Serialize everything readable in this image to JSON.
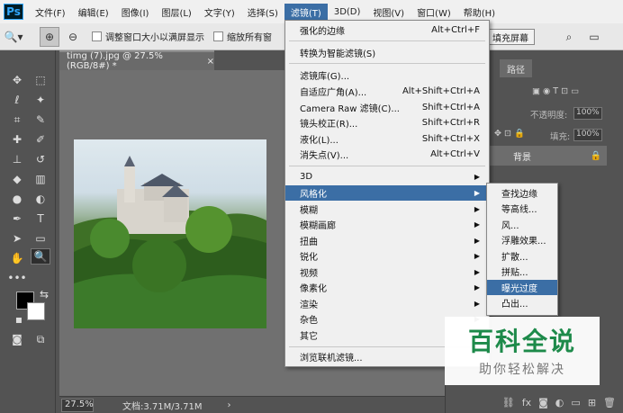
{
  "menubar": {
    "logo": "Ps",
    "items": [
      "文件(F)",
      "编辑(E)",
      "图像(I)",
      "图层(L)",
      "文字(Y)",
      "选择(S)",
      "滤镜(T)",
      "3D(D)",
      "视图(V)",
      "窗口(W)",
      "帮助(H)"
    ],
    "active_index": 6
  },
  "options": {
    "resize_windows": "调整窗口大小以满屏显示",
    "zoom_all": "缩放所有窗",
    "fill_screen": "填充屏幕"
  },
  "document": {
    "tab_title": "timg (7).jpg @ 27.5%(RGB/8#) *",
    "close": "×",
    "zoom": "27.5%",
    "doc_info": "文档:3.71M/3.71M",
    "status_arrow": "›"
  },
  "panel": {
    "tab": "路径",
    "opacity_label": "不透明度:",
    "opacity_value": "100%",
    "fill_label": "填充:",
    "fill_value": "100%",
    "layer_name": "背景"
  },
  "filter_menu": {
    "items": [
      {
        "label": "强化的边缘",
        "shortcut": "Alt+Ctrl+F"
      },
      {
        "label": "转换为智能滤镜(S)",
        "shortcut": ""
      },
      {
        "label": "滤镜库(G)...",
        "shortcut": ""
      },
      {
        "label": "自适应广角(A)...",
        "shortcut": "Alt+Shift+Ctrl+A"
      },
      {
        "label": "Camera Raw 滤镜(C)...",
        "shortcut": "Shift+Ctrl+A"
      },
      {
        "label": "镜头校正(R)...",
        "shortcut": "Shift+Ctrl+R"
      },
      {
        "label": "液化(L)...",
        "shortcut": "Shift+Ctrl+X"
      },
      {
        "label": "消失点(V)...",
        "shortcut": "Alt+Ctrl+V"
      },
      {
        "label": "3D",
        "shortcut": ""
      },
      {
        "label": "风格化",
        "shortcut": ""
      },
      {
        "label": "模糊",
        "shortcut": ""
      },
      {
        "label": "模糊画廊",
        "shortcut": ""
      },
      {
        "label": "扭曲",
        "shortcut": ""
      },
      {
        "label": "锐化",
        "shortcut": ""
      },
      {
        "label": "视频",
        "shortcut": ""
      },
      {
        "label": "像素化",
        "shortcut": ""
      },
      {
        "label": "渲染",
        "shortcut": ""
      },
      {
        "label": "杂色",
        "shortcut": ""
      },
      {
        "label": "其它",
        "shortcut": ""
      },
      {
        "label": "浏览联机滤镜...",
        "shortcut": ""
      }
    ]
  },
  "stylize_submenu": {
    "items": [
      "查找边缘",
      "等高线...",
      "风...",
      "浮雕效果...",
      "扩散...",
      "拼贴...",
      "曝光过度",
      "凸出..."
    ]
  },
  "watermark": {
    "title": "百科全说",
    "subtitle": "助你轻松解决"
  },
  "icons": {
    "zoom": "🔍",
    "arrow_right": "▶"
  }
}
